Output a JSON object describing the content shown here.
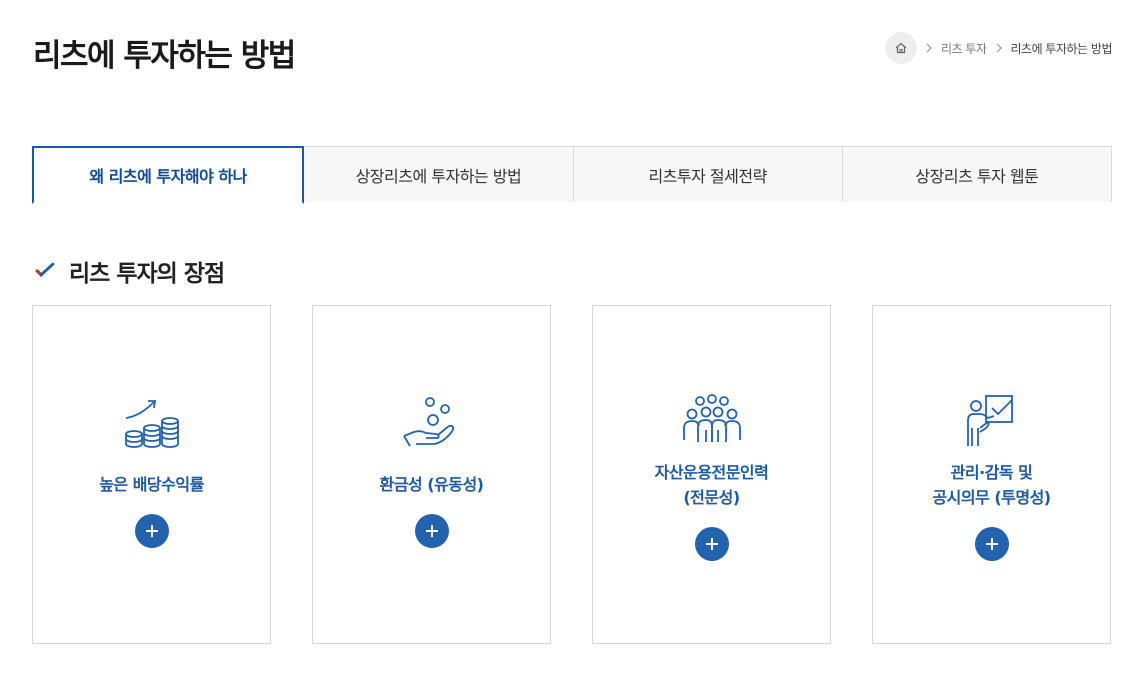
{
  "page": {
    "title": "리츠에 투자하는 방법"
  },
  "breadcrumb": {
    "home_icon": "home-icon",
    "items": [
      "리츠 투자",
      "리츠에 투자하는 방법"
    ]
  },
  "tabs": [
    {
      "label": "왜 리츠에 투자해야 하나",
      "active": true
    },
    {
      "label": "상장리츠에 투자하는 방법",
      "active": false
    },
    {
      "label": "리츠투자 절세전략",
      "active": false
    },
    {
      "label": "상장리츠 투자 웹툰",
      "active": false
    }
  ],
  "section": {
    "title": "리츠 투자의 장점",
    "icon": "checkmark-icon"
  },
  "cards": [
    {
      "lines": [
        "높은 배당수익률"
      ],
      "icon": "coins-growth-icon"
    },
    {
      "lines": [
        "환금성 (유동성)"
      ],
      "icon": "hand-coins-icon"
    },
    {
      "lines": [
        "자산운용전문인력",
        "(전문성)"
      ],
      "icon": "people-group-icon"
    },
    {
      "lines": [
        "관리·감독 및",
        "공시의무 (투명성)"
      ],
      "icon": "presenter-board-icon"
    }
  ],
  "colors": {
    "accent": "#1d5aa0",
    "button": "#2363ad",
    "tab_active_border": "#1a5aa0"
  }
}
